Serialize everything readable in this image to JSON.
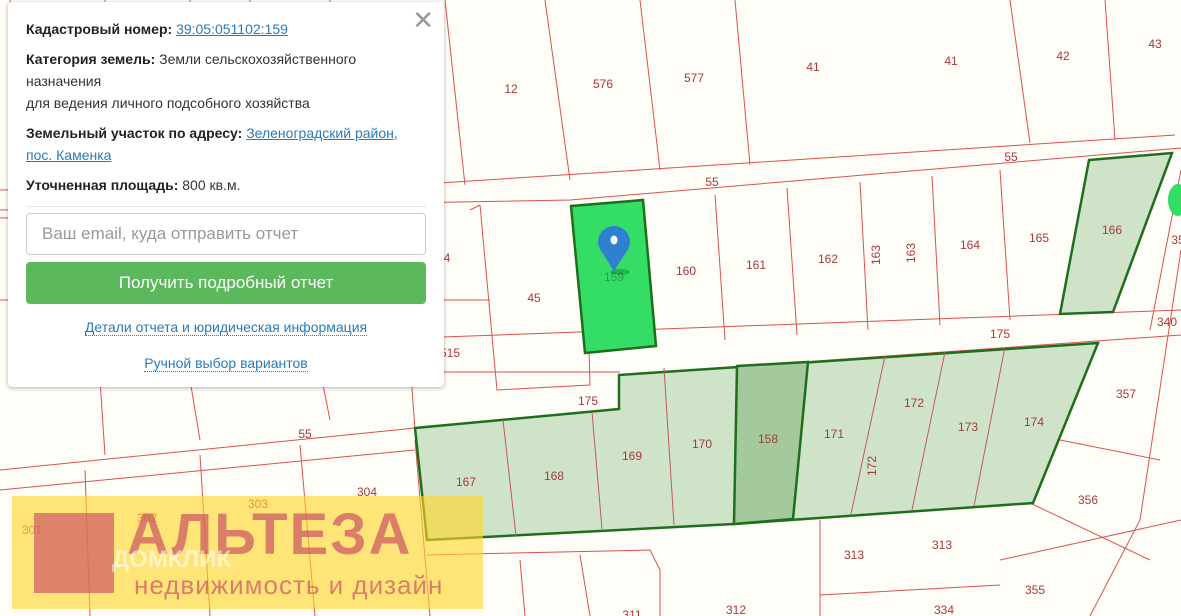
{
  "popup": {
    "cadastral_label": "Кадастровый номер:",
    "cadastral_value": "39:05:051102:159",
    "category_label": "Категория земель:",
    "category_value": "Земли сельскохозяйственного назначения",
    "category_use": "для ведения личного подсобного хозяйства",
    "address_label": "Земельный участок по адресу:",
    "address_value": "Зеленоградский район, пос. Каменка",
    "area_label": "Уточненная площадь:",
    "area_value": "800 кв.м.",
    "email_placeholder": "Ваш email, куда отправить отчет",
    "email_value": "",
    "submit_label": "Получить подробный отчет",
    "details_link": "Детали отчета и юридическая информация",
    "manual_link": "Ручной выбор вариантов",
    "close_icon": "✕"
  },
  "watermark": {
    "title": "АЛЬТЕЗА",
    "subtitle": "недвижимость и дизайн",
    "secondary": "ДОМКЛИК"
  },
  "map": {
    "selected_parcel": "159",
    "colors": {
      "boundary": "#d9534f",
      "selected": "#33dd66",
      "group": "#cfe3c8",
      "group_border": "#1e6e1e",
      "marker": "#2f80d0"
    },
    "labels": [
      "12",
      "576",
      "577",
      "41",
      "41",
      "42",
      "43",
      "55",
      "55",
      "4",
      "45",
      "159",
      "160",
      "161",
      "162",
      "163",
      "163",
      "164",
      "165",
      "166",
      "35",
      "175",
      "340",
      "515",
      "175",
      "55",
      "357",
      "167",
      "168",
      "169",
      "170",
      "158",
      "171",
      "172",
      "172",
      "173",
      "174",
      "356",
      "301",
      "302",
      "303",
      "304",
      "313",
      "313",
      "355",
      "311",
      "312",
      "334"
    ]
  }
}
